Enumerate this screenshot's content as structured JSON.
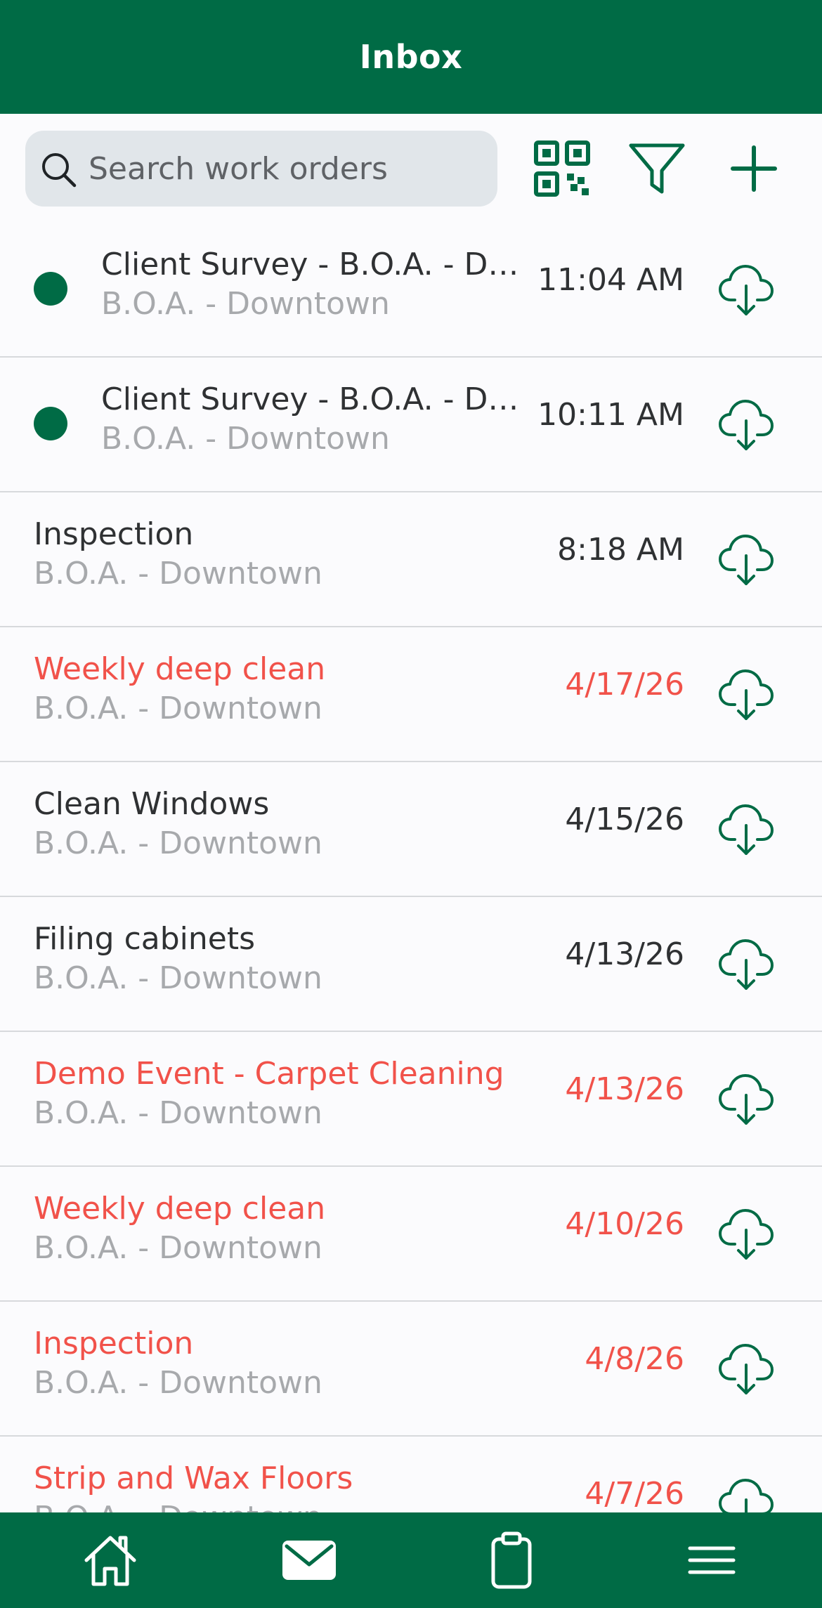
{
  "header": {
    "title": "Inbox"
  },
  "search": {
    "placeholder": "Search work orders"
  },
  "toolbar": {
    "qr_icon": "qr-code-icon",
    "filter_icon": "filter-icon",
    "add_icon": "plus-icon"
  },
  "colors": {
    "brand": "#006b45",
    "overdue": "#f1524a",
    "text": "#2f3133",
    "subtext": "#a7a9ac",
    "search_bg": "#e1e6ea"
  },
  "work_orders": [
    {
      "title": "Client Survey - B.O.A. - Do…",
      "location": "B.O.A. - Downtown",
      "date": "11:04 AM",
      "unread": true,
      "overdue": false
    },
    {
      "title": "Client Survey - B.O.A. - Do…",
      "location": "B.O.A. - Downtown",
      "date": "10:11 AM",
      "unread": true,
      "overdue": false
    },
    {
      "title": "Inspection",
      "location": "B.O.A. - Downtown",
      "date": "8:18 AM",
      "unread": false,
      "overdue": false
    },
    {
      "title": "Weekly deep clean",
      "location": "B.O.A. - Downtown",
      "date": "4/17/26",
      "unread": false,
      "overdue": true
    },
    {
      "title": "Clean Windows",
      "location": "B.O.A. - Downtown",
      "date": "4/15/26",
      "unread": false,
      "overdue": false
    },
    {
      "title": "Filing cabinets",
      "location": "B.O.A. - Downtown",
      "date": "4/13/26",
      "unread": false,
      "overdue": false
    },
    {
      "title": "Demo Event - Carpet Cleaning",
      "location": "B.O.A. - Downtown",
      "date": "4/13/26",
      "unread": false,
      "overdue": true
    },
    {
      "title": "Weekly deep clean",
      "location": "B.O.A. - Downtown",
      "date": "4/10/26",
      "unread": false,
      "overdue": true
    },
    {
      "title": "Inspection",
      "location": "B.O.A. - Downtown",
      "date": "4/8/26",
      "unread": false,
      "overdue": true
    },
    {
      "title": "Strip and Wax Floors",
      "location": "B.O.A. - Downtown",
      "date": "4/7/26",
      "unread": false,
      "overdue": true
    }
  ],
  "row_icon": "cloud-download-icon",
  "bottom_nav": [
    {
      "icon": "home-icon"
    },
    {
      "icon": "mail-icon",
      "active": true
    },
    {
      "icon": "clipboard-icon"
    },
    {
      "icon": "menu-icon"
    }
  ]
}
